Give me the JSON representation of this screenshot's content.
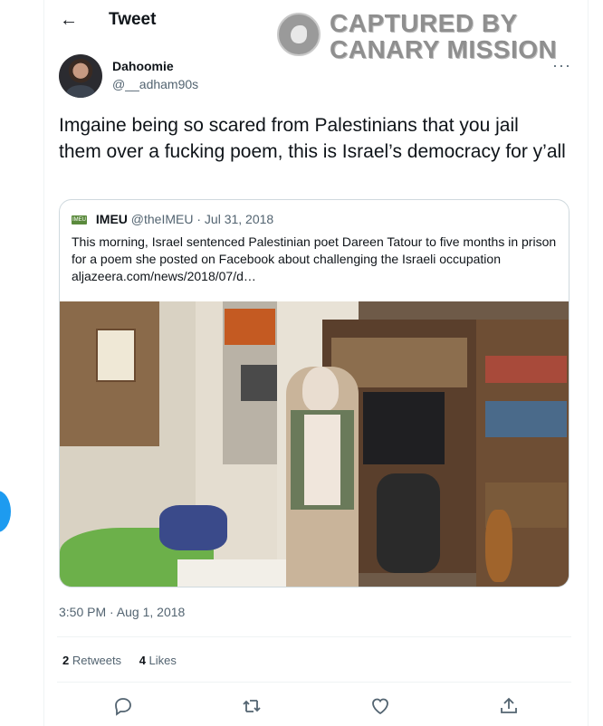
{
  "header": {
    "title": "Tweet",
    "back_icon": "arrow-left-icon"
  },
  "watermark": {
    "line1": "CAPTURED BY",
    "line2": "CANARY MISSION"
  },
  "tweet": {
    "author_name": "Dahoomie",
    "author_handle": "@__adham90s",
    "text": "Imgaine being so scared from Palestinians that you jail them over a fucking poem, this is Israel’s democracy for y’all",
    "more_label": "···",
    "timestamp": "3:50 PM · Aug 1, 2018"
  },
  "quote": {
    "logo_text": "IMEU",
    "name": "IMEU",
    "handle": "@theIMEU",
    "date": "· Jul 31, 2018",
    "text": "This morning, Israel sentenced Palestinian poet Dareen Tatour to five months in prison for a poem she posted on Facebook about challenging the Israeli occupation aljazeera.com/news/2018/07/d…"
  },
  "stats": {
    "retweets_count": "2",
    "retweets_label": "Retweets",
    "likes_count": "4",
    "likes_label": "Likes"
  },
  "actions": [
    "reply-icon",
    "retweet-icon",
    "like-icon",
    "share-icon"
  ],
  "colors": {
    "accent": "#1d9bf0",
    "secondary_text": "#536471",
    "border": "#cfd9de"
  }
}
